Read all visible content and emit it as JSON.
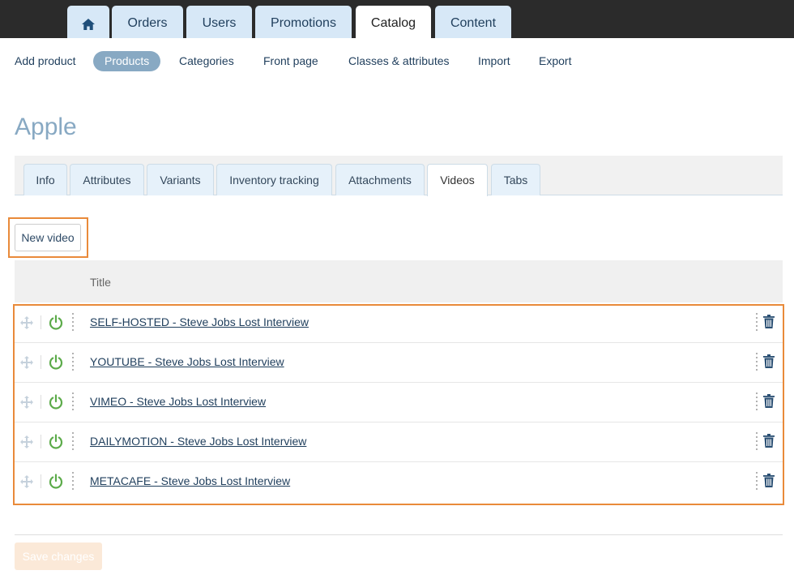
{
  "topnav": {
    "tabs": [
      {
        "label": "",
        "icon": "home-icon"
      },
      {
        "label": "Orders"
      },
      {
        "label": "Users"
      },
      {
        "label": "Promotions"
      },
      {
        "label": "Catalog",
        "active": true
      },
      {
        "label": "Content"
      }
    ]
  },
  "subnav": {
    "items": [
      {
        "label": "Add product"
      },
      {
        "label": "Products",
        "active": true
      },
      {
        "label": "Categories"
      },
      {
        "label": "Front page"
      },
      {
        "label": "Classes & attributes"
      },
      {
        "label": "Import"
      },
      {
        "label": "Export"
      }
    ]
  },
  "page": {
    "title": "Apple"
  },
  "product_tabs": [
    {
      "label": "Info"
    },
    {
      "label": "Attributes"
    },
    {
      "label": "Variants"
    },
    {
      "label": "Inventory tracking"
    },
    {
      "label": "Attachments"
    },
    {
      "label": "Videos",
      "active": true
    },
    {
      "label": "Tabs"
    }
  ],
  "actions": {
    "new_video": "New video",
    "save": "Save changes"
  },
  "table": {
    "header_title": "Title",
    "rows": [
      {
        "title": "SELF-HOSTED - Steve Jobs Lost Interview"
      },
      {
        "title": "YOUTUBE - Steve Jobs Lost Interview"
      },
      {
        "title": "VIMEO - Steve Jobs Lost Interview"
      },
      {
        "title": "DAILYMOTION - Steve Jobs Lost Interview"
      },
      {
        "title": "METACAFE - Steve Jobs Lost Interview"
      }
    ]
  },
  "colors": {
    "topbar": "#2b2b2b",
    "tab_bg": "#d7e8f7",
    "link": "#1f3e5c",
    "accent": "#88a9c3",
    "highlight": "#e98a3a",
    "power_on": "#5cab4a"
  }
}
